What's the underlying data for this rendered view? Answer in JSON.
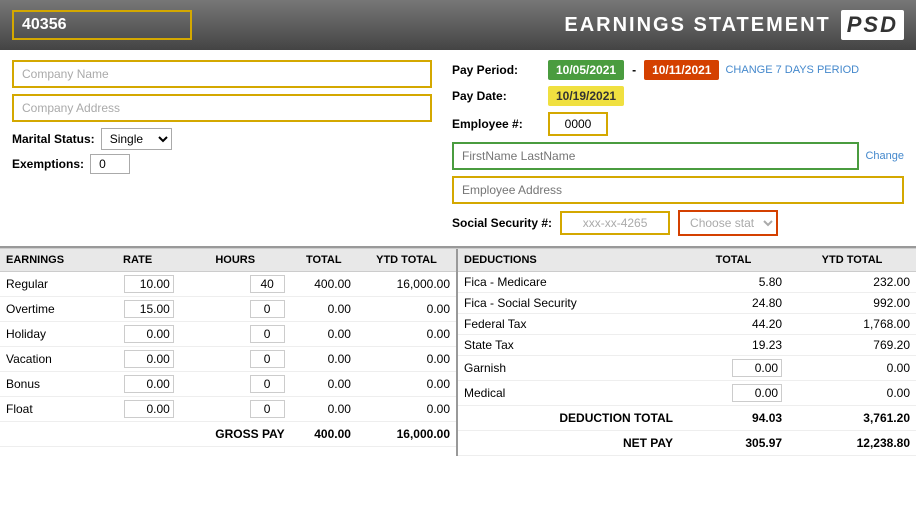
{
  "header": {
    "id_value": "40356",
    "title": "EARNINGS STATEMENT",
    "logo": "PSD"
  },
  "pay_info": {
    "pay_period_label": "Pay Period:",
    "pay_date_label": "Pay Date:",
    "employee_num_label": "Employee #:",
    "pay_period_start": "10/05/2021",
    "pay_period_end": "10/11/2021",
    "change_period_link": "CHANGE 7 DAYS PERIOD",
    "pay_date": "10/19/2021",
    "employee_num": "0000",
    "dash": "-",
    "change_link": "Change"
  },
  "company": {
    "name_placeholder": "Company Name",
    "address_placeholder": "Company Address",
    "marital_label": "Marital Status:",
    "marital_value": "Single",
    "exemptions_label": "Exemptions:",
    "exemptions_value": "0"
  },
  "employee": {
    "name_placeholder": "FirstName LastName",
    "address_placeholder": "Employee Address",
    "ss_label": "Social Security #:",
    "ss_value": "xxx-xx-4265",
    "state_placeholder": "Choose state"
  },
  "earnings": {
    "headers": [
      "EARNINGS",
      "RATE",
      "HOURS",
      "TOTAL",
      "YTD TOTAL"
    ],
    "rows": [
      {
        "name": "Regular",
        "rate": "10.00",
        "hours": "40",
        "total": "400.00",
        "ytd": "16,000.00"
      },
      {
        "name": "Overtime",
        "rate": "15.00",
        "hours": "0",
        "total": "0.00",
        "ytd": "0.00"
      },
      {
        "name": "Holiday",
        "rate": "0.00",
        "hours": "0",
        "total": "0.00",
        "ytd": "0.00"
      },
      {
        "name": "Vacation",
        "rate": "0.00",
        "hours": "0",
        "total": "0.00",
        "ytd": "0.00"
      },
      {
        "name": "Bonus",
        "rate": "0.00",
        "hours": "0",
        "total": "0.00",
        "ytd": "0.00"
      },
      {
        "name": "Float",
        "rate": "0.00",
        "hours": "0",
        "total": "0.00",
        "ytd": "0.00"
      }
    ],
    "gross_pay_label": "GROSS PAY",
    "gross_pay_total": "400.00",
    "gross_pay_ytd": "16,000.00"
  },
  "deductions": {
    "headers": [
      "DEDUCTIONS",
      "TOTAL",
      "YTD TOTAL"
    ],
    "rows": [
      {
        "name": "Fica - Medicare",
        "total": "5.80",
        "ytd": "232.00"
      },
      {
        "name": "Fica - Social Security",
        "total": "24.80",
        "ytd": "992.00"
      },
      {
        "name": "Federal Tax",
        "total": "44.20",
        "ytd": "1,768.00"
      },
      {
        "name": "State Tax",
        "total": "19.23",
        "ytd": "769.20"
      },
      {
        "name": "Garnish",
        "total": "0.00",
        "ytd": "0.00",
        "editable": true
      },
      {
        "name": "Medical",
        "total": "0.00",
        "ytd": "0.00",
        "editable": true
      }
    ],
    "deduction_total_label": "DEDUCTION TOTAL",
    "deduction_total": "94.03",
    "deduction_ytd": "3,761.20",
    "net_pay_label": "NET PAY",
    "net_pay_total": "305.97",
    "net_pay_ytd": "12,238.80"
  }
}
